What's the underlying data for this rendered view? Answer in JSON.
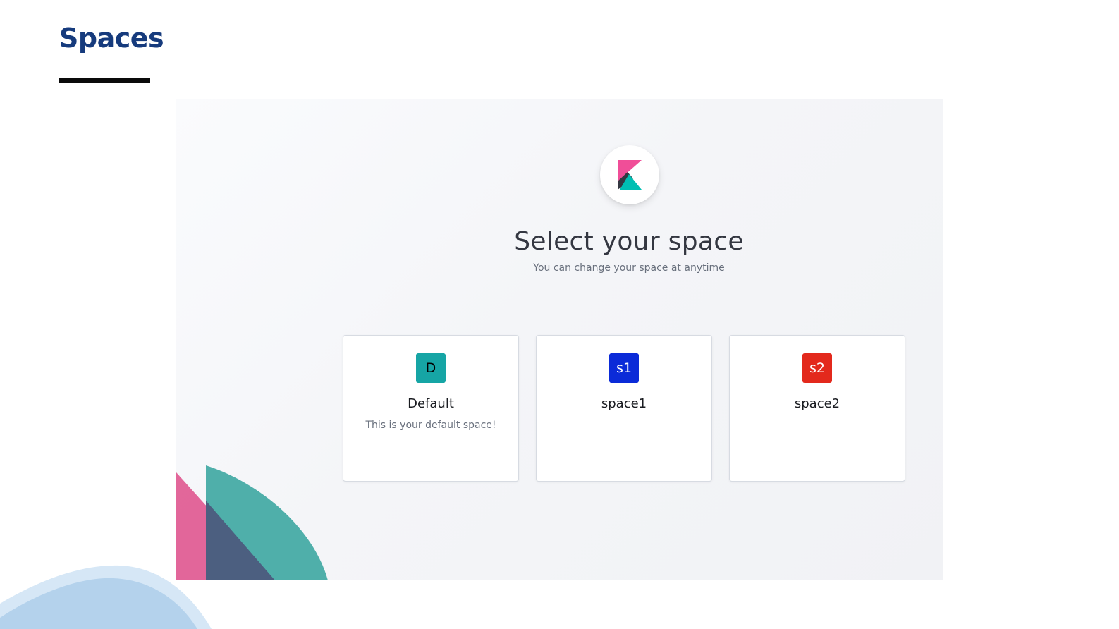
{
  "slide": {
    "title": "Spaces"
  },
  "login": {
    "title": "Select your space",
    "subtitle": "You can change your space at anytime",
    "spaces": [
      {
        "initials": "D",
        "name": "Default",
        "description": "This is your default space!",
        "color": "#16a5a5",
        "text_color": "#000000"
      },
      {
        "initials": "s1",
        "name": "space1",
        "description": "",
        "color": "#0b2bd8",
        "text_color": "#ffffff"
      },
      {
        "initials": "s2",
        "name": "space2",
        "description": "",
        "color": "#e3291c",
        "text_color": "#ffffff"
      }
    ]
  },
  "colors": {
    "title_blue": "#163b7d",
    "kibana_pink": "#f04e98",
    "kibana_teal": "#00bfb3",
    "kibana_dark": "#343741"
  },
  "icons": {
    "logo": "kibana-logo-icon"
  }
}
